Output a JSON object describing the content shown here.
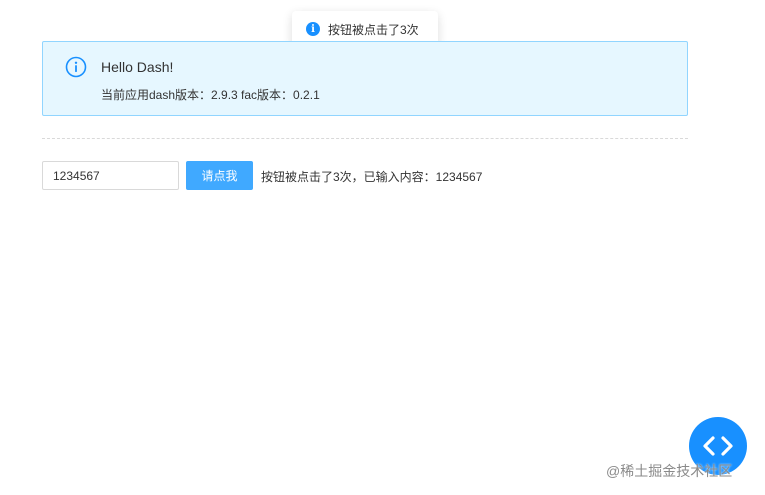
{
  "toast": {
    "icon": "info-icon",
    "message": "按钮被点击了3次"
  },
  "alert": {
    "icon": "info-circle-icon",
    "title": "Hello Dash!",
    "description": "当前应用dash版本：2.9.3 fac版本：0.2.1"
  },
  "form": {
    "input_value": "1234567",
    "button_label": "请点我",
    "status_text": "按钮被点击了3次，已输入内容：1234567"
  },
  "fab": {
    "icon": "code-icon"
  },
  "watermark": {
    "text": "@稀土掘金技术社区"
  },
  "colors": {
    "primary": "#1890ff",
    "button": "#40a9ff",
    "alert_bg": "#e6f7ff",
    "alert_border": "#91d5ff"
  }
}
